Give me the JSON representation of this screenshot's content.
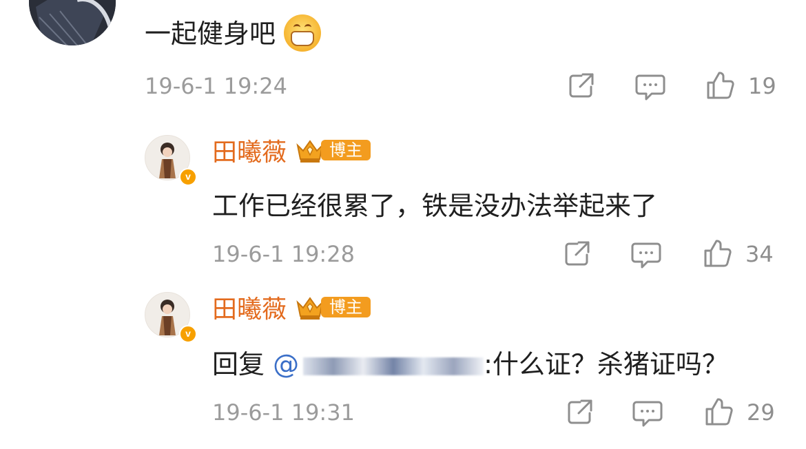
{
  "comment_top": {
    "text": "一起健身吧",
    "emoji_icon": "grin-emoji-icon",
    "time": "19-6-1 19:24",
    "like_count": "19"
  },
  "replies": [
    {
      "username": "田曦薇",
      "badge": "博主",
      "text": "工作已经很累了，铁是没办法举起来了",
      "time": "19-6-1 19:28",
      "like_count": "34"
    },
    {
      "username": "田曦薇",
      "badge": "博主",
      "reply_prefix": "回复",
      "mention": "@",
      "text_after": ":什么证？杀猪证吗？",
      "time": "19-6-1 19:31",
      "like_count": "29"
    }
  ],
  "icons": {
    "share": "share-icon",
    "comment": "comment-icon",
    "like": "thumbs-up-icon",
    "verified": "verified-badge-icon",
    "crown": "crown-icon"
  },
  "colors": {
    "username": "#e36b1e",
    "badge": "#f39c1f",
    "meta": "#9b9b9b",
    "mention": "#3b6fc8"
  }
}
